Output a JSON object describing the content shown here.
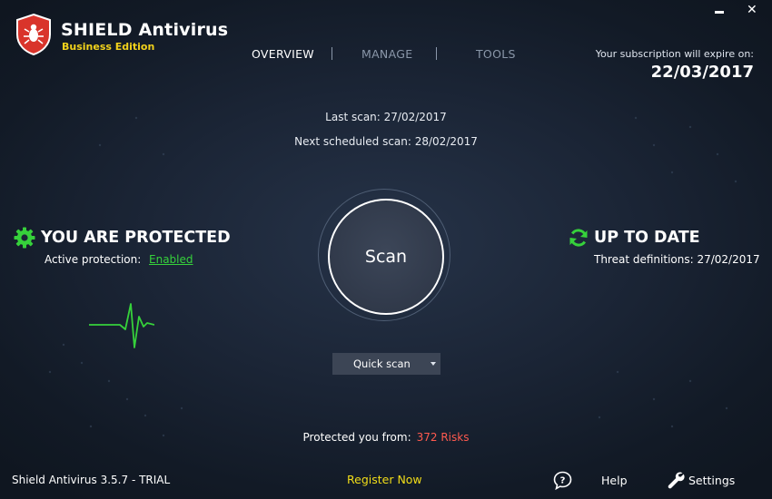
{
  "app": {
    "name": "SHIELD Antivirus",
    "edition": "Business Edition",
    "logo_icon": "shield-bug-icon",
    "brand_red": "#d9342b",
    "accent_green": "#36d13b",
    "accent_yellow": "#f2dd19"
  },
  "nav": {
    "tabs": [
      {
        "label": "OVERVIEW",
        "active": true
      },
      {
        "label": "MANAGE",
        "active": false
      },
      {
        "label": "TOOLS",
        "active": false
      }
    ]
  },
  "subscription": {
    "label": "Your subscription will expire on:",
    "date": "22/03/2017"
  },
  "window_controls": {
    "minimize_icon": "minimize-icon",
    "close_label": "✕"
  },
  "scan_info": {
    "last_scan": "Last scan: 27/02/2017",
    "next_scan": "Next scheduled scan: 28/02/2017"
  },
  "scan": {
    "button_label": "Scan",
    "quick_scan_label": "Quick scan"
  },
  "protection": {
    "title": "YOU ARE PROTECTED",
    "active_label": "Active protection:",
    "status": "Enabled",
    "icon": "gear-icon"
  },
  "update": {
    "title": "UP TO DATE",
    "definitions": "Threat definitions: 27/02/2017",
    "icon": "refresh-icon"
  },
  "risks": {
    "label": "Protected you from:",
    "value": "372 Risks"
  },
  "footer": {
    "version": "Shield Antivirus 3.5.7 - TRIAL",
    "register": "Register Now",
    "help": "Help",
    "settings": "Settings"
  }
}
